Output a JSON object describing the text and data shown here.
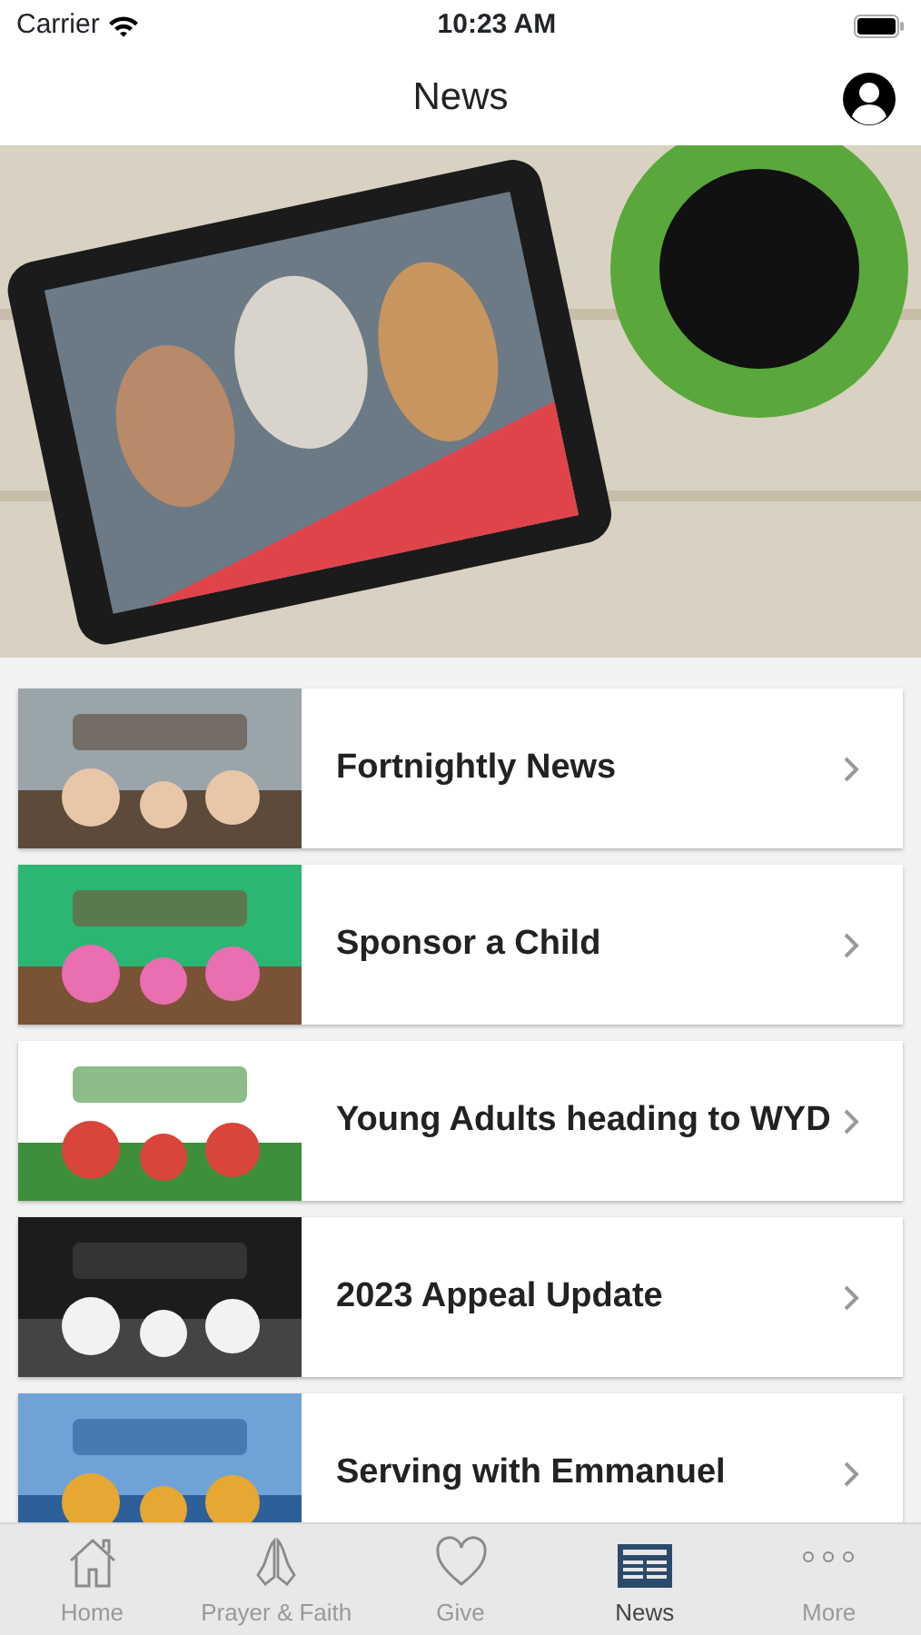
{
  "status_bar": {
    "carrier": "Carrier",
    "time": "10:23 AM"
  },
  "nav": {
    "title": "News"
  },
  "items": [
    {
      "title": "Fortnightly News"
    },
    {
      "title": "Sponsor a Child"
    },
    {
      "title": "Young Adults heading to WYD"
    },
    {
      "title": "2023 Appeal Update"
    },
    {
      "title": "Serving with Emmanuel"
    }
  ],
  "tabs": [
    {
      "label": "Home",
      "kind": "home",
      "selected": false
    },
    {
      "label": "Prayer & Faith",
      "kind": "prayer",
      "selected": false
    },
    {
      "label": "Give",
      "kind": "give",
      "selected": false
    },
    {
      "label": "News",
      "kind": "news",
      "selected": true
    },
    {
      "label": "More",
      "kind": "more",
      "selected": false
    }
  ]
}
